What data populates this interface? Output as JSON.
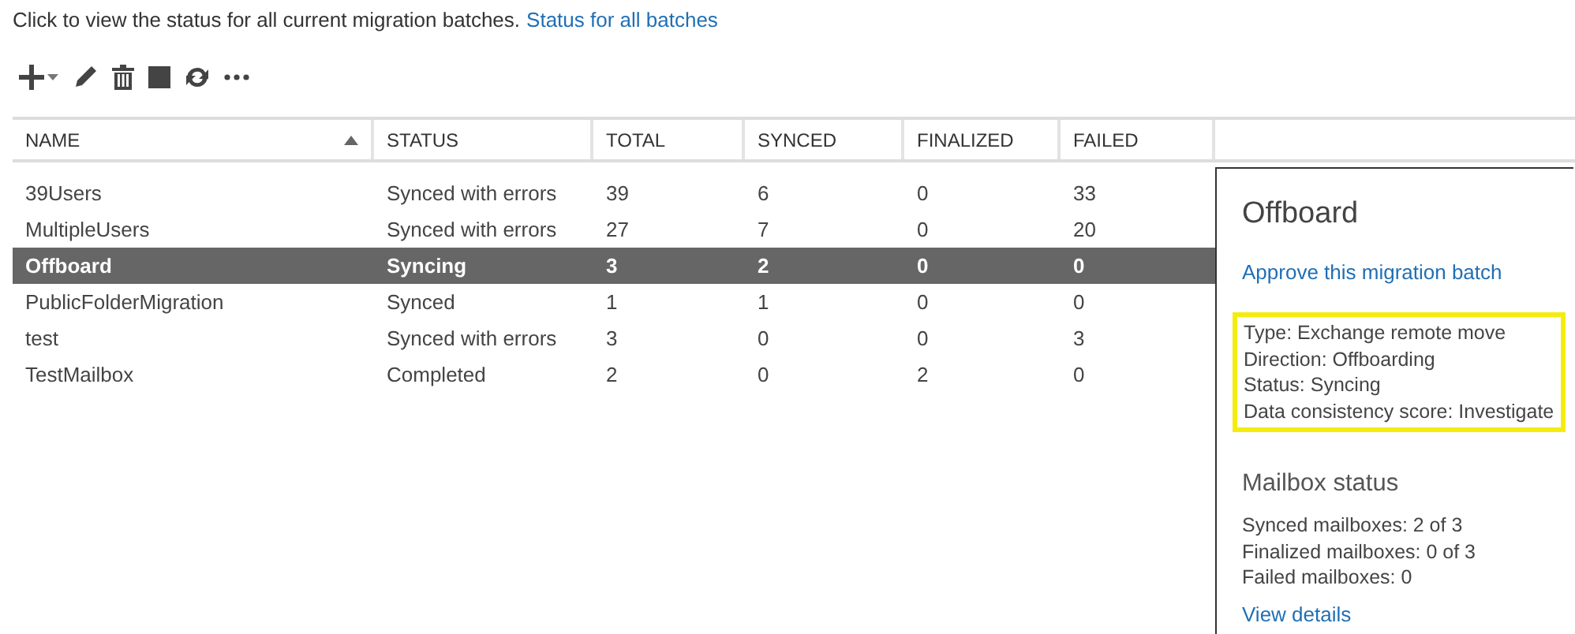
{
  "intro": {
    "text": "Click to view the status for all current migration batches.",
    "link": "Status for all batches"
  },
  "toolbar": [
    {
      "kind": "add"
    },
    {
      "kind": "edit"
    },
    {
      "kind": "delete"
    },
    {
      "kind": "stop"
    },
    {
      "kind": "refresh"
    },
    {
      "kind": "more"
    }
  ],
  "table": {
    "columns": [
      {
        "label": "NAME",
        "sorted": true
      },
      {
        "label": "STATUS",
        "sorted": false
      },
      {
        "label": "TOTAL",
        "sorted": false
      },
      {
        "label": "SYNCED",
        "sorted": false
      },
      {
        "label": "FINALIZED",
        "sorted": false
      },
      {
        "label": "FAILED",
        "sorted": false
      }
    ],
    "rows": [
      {
        "cells": [
          "39Users",
          "Synced with errors",
          "39",
          "6",
          "0",
          "33"
        ],
        "selected": false
      },
      {
        "cells": [
          "MultipleUsers",
          "Synced with errors",
          "27",
          "7",
          "0",
          "20"
        ],
        "selected": false
      },
      {
        "cells": [
          "Offboard",
          "Syncing",
          "3",
          "2",
          "0",
          "0"
        ],
        "selected": true
      },
      {
        "cells": [
          "PublicFolderMigration",
          "Synced",
          "1",
          "1",
          "0",
          "0"
        ],
        "selected": false
      },
      {
        "cells": [
          "test",
          "Synced with errors",
          "3",
          "0",
          "0",
          "3"
        ],
        "selected": false
      },
      {
        "cells": [
          "TestMailbox",
          "Completed",
          "2",
          "0",
          "2",
          "0"
        ],
        "selected": false
      }
    ]
  },
  "details": {
    "title": "Offboard",
    "action": "Approve this migration batch",
    "properties": {
      "highlighted": true,
      "lines": [
        "Type: Exchange remote move",
        "Direction: Offboarding",
        "Status: Syncing",
        "Data consistency score: Investigate"
      ]
    },
    "mailbox_status": {
      "heading": "Mailbox status",
      "lines": [
        "Synced mailboxes: 2 of 3",
        "Finalized mailboxes: 0 of 3",
        "Failed mailboxes: 0"
      ],
      "link": "View details"
    }
  }
}
